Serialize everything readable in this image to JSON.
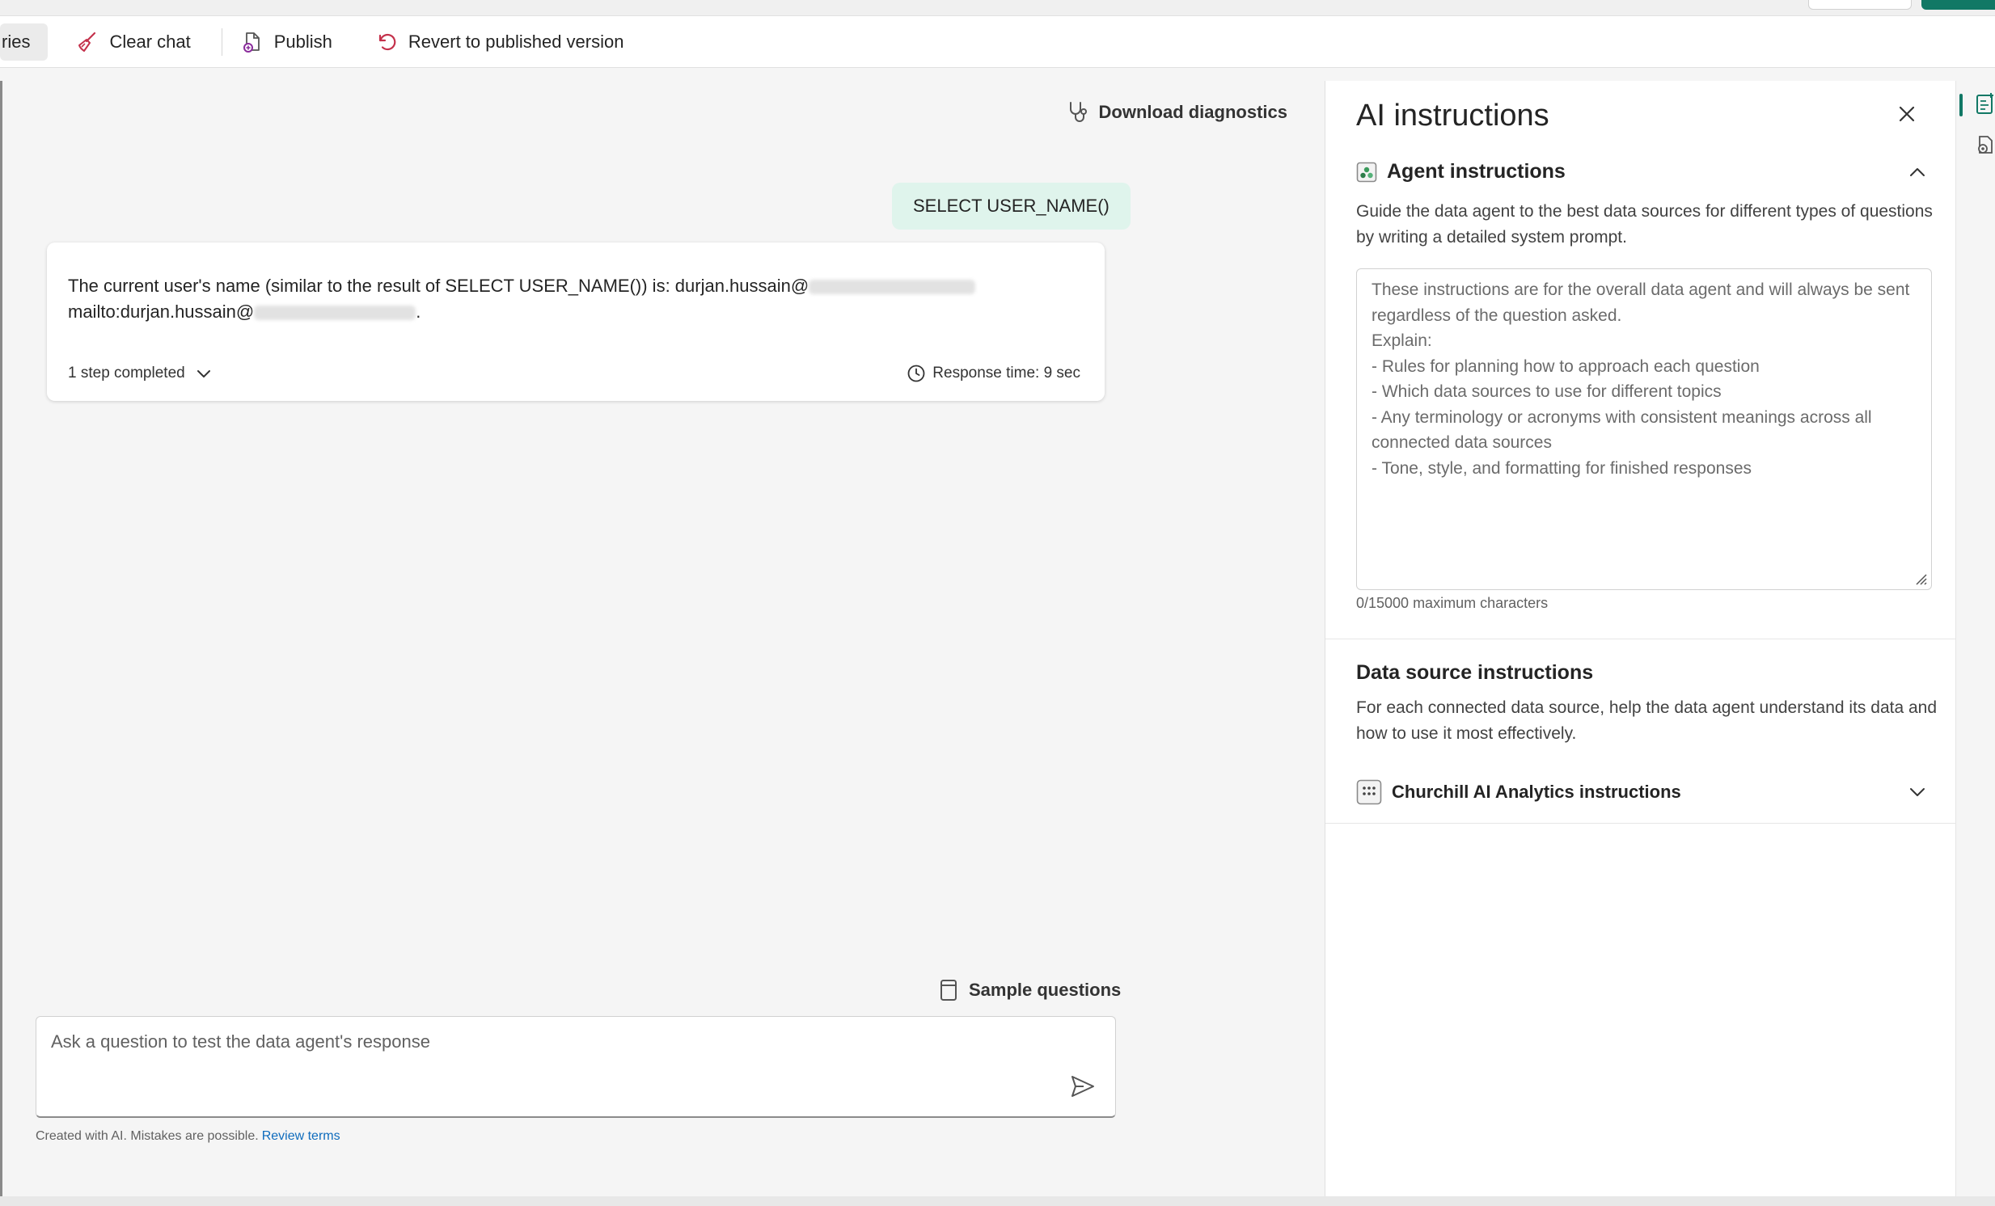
{
  "toolbar": {
    "partial_tab": "ries",
    "clear_chat": "Clear chat",
    "publish": "Publish",
    "revert": "Revert to published version"
  },
  "chat": {
    "download_diagnostics": "Download diagnostics",
    "user_message": "SELECT USER_NAME()",
    "response": {
      "line1": "The current user's name (similar to the result of SELECT USER_NAME()) is: durjan.hussain@",
      "line2": "mailto:durjan.hussain@",
      "line2_end": ".",
      "steps": "1 step completed",
      "response_time": "Response time: 9 sec"
    },
    "sample_questions": "Sample questions",
    "input_placeholder": "Ask a question to test the data agent's response",
    "disclaimer": "Created with AI. Mistakes are possible.",
    "review_terms": "Review terms"
  },
  "panel": {
    "title": "AI instructions",
    "agent_section_title": "Agent instructions",
    "agent_section_desc": "Guide the data agent to the best data sources for different types of questions by writing a detailed system prompt.",
    "instructions_placeholder": "These instructions are for the overall data agent and will always be sent regardless of the question asked.\nExplain:\n- Rules for planning how to approach each question\n- Which data sources to use for different topics\n- Any terminology or acronyms with consistent meanings across all connected data sources\n- Tone, style, and formatting for finished responses",
    "char_count": "0/15000 maximum characters",
    "data_source_title": "Data source instructions",
    "data_source_desc": "For each connected data source, help the data agent understand its data and how to use it most effectively.",
    "data_source_item": "Churchill AI Analytics instructions"
  },
  "colors": {
    "accent": "#117865",
    "user_bubble": "#dff4ec",
    "link": "#0f6cbd"
  }
}
